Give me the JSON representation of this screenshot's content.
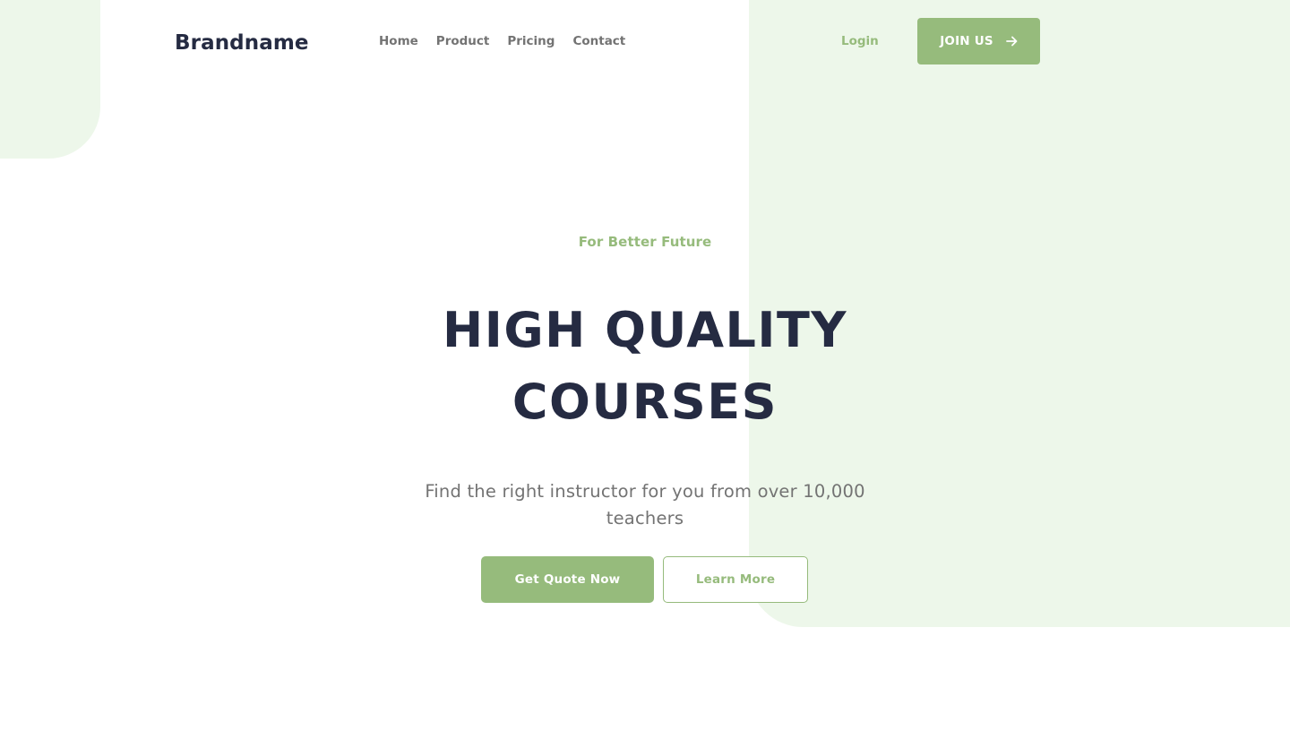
{
  "colors": {
    "accent": "#96bb7c",
    "accent_light_bg": "#edf7ea",
    "heading": "#252b42",
    "muted_text": "#737373"
  },
  "header": {
    "brand": "Brandname",
    "nav": [
      {
        "label": "Home"
      },
      {
        "label": "Product"
      },
      {
        "label": "Pricing"
      },
      {
        "label": "Contact"
      }
    ],
    "login_label": "Login",
    "join_label": "JOIN US",
    "join_icon": "arrow-right-icon"
  },
  "hero": {
    "eyebrow": "For Better Future",
    "title_line1": "HIGH QUALITY",
    "title_line2": "COURSES",
    "subtitle": "Find the right instructor for you from over 10,000 teachers",
    "primary_cta": "Get Quote Now",
    "secondary_cta": "Learn More"
  }
}
